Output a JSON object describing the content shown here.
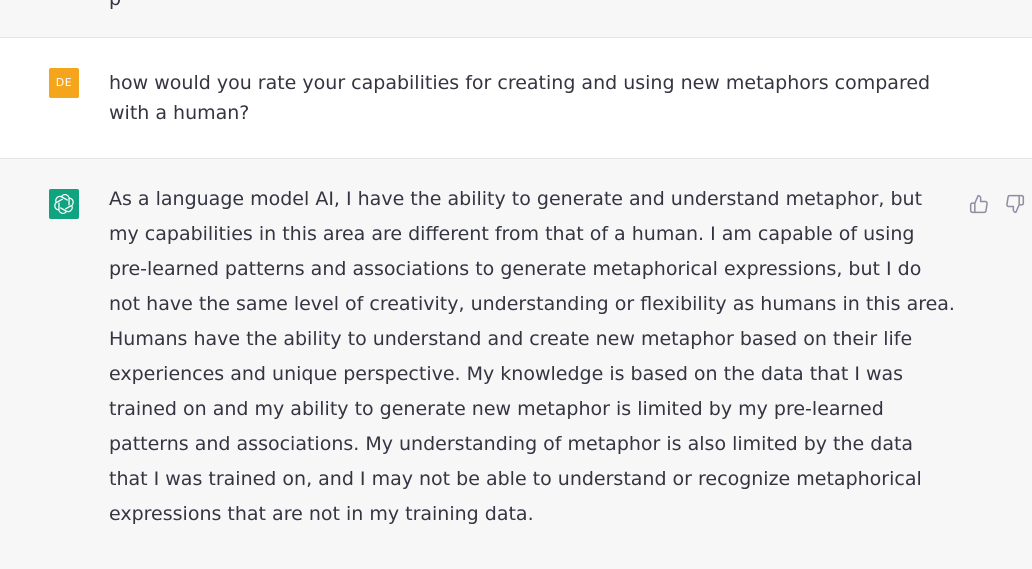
{
  "conversation": {
    "previous_cut_text": "p",
    "user": {
      "avatar_initials": "DE",
      "message": "how would you rate your capabilities for creating and using new metaphors compared with a human?"
    },
    "assistant": {
      "message": "As a language model AI, I have the ability to generate and understand metaphor, but my capabilities in this area are different from that of a human. I am capable of using pre-learned patterns and associations to generate metaphorical expressions, but I do not have the same level of creativity, understanding or flexibility as humans in this area. Humans have the ability to understand and create new metaphor based on their life experiences and unique perspective. My knowledge is based on the data that I was trained on and my ability to generate new metaphor is limited by my pre-learned patterns and associations. My understanding of metaphor is also limited by the data that I was trained on, and I may not be able to understand or recognize metaphorical expressions that are not in my training data.",
      "icons": {
        "avatar": "openai-logo-icon",
        "thumbs_up": "thumbs-up-icon",
        "thumbs_down": "thumbs-down-icon"
      }
    }
  },
  "colors": {
    "user_avatar_bg": "#f4a51c",
    "assistant_avatar_bg": "#10a37f",
    "assistant_row_bg": "#f7f7f8",
    "text": "#343541"
  }
}
